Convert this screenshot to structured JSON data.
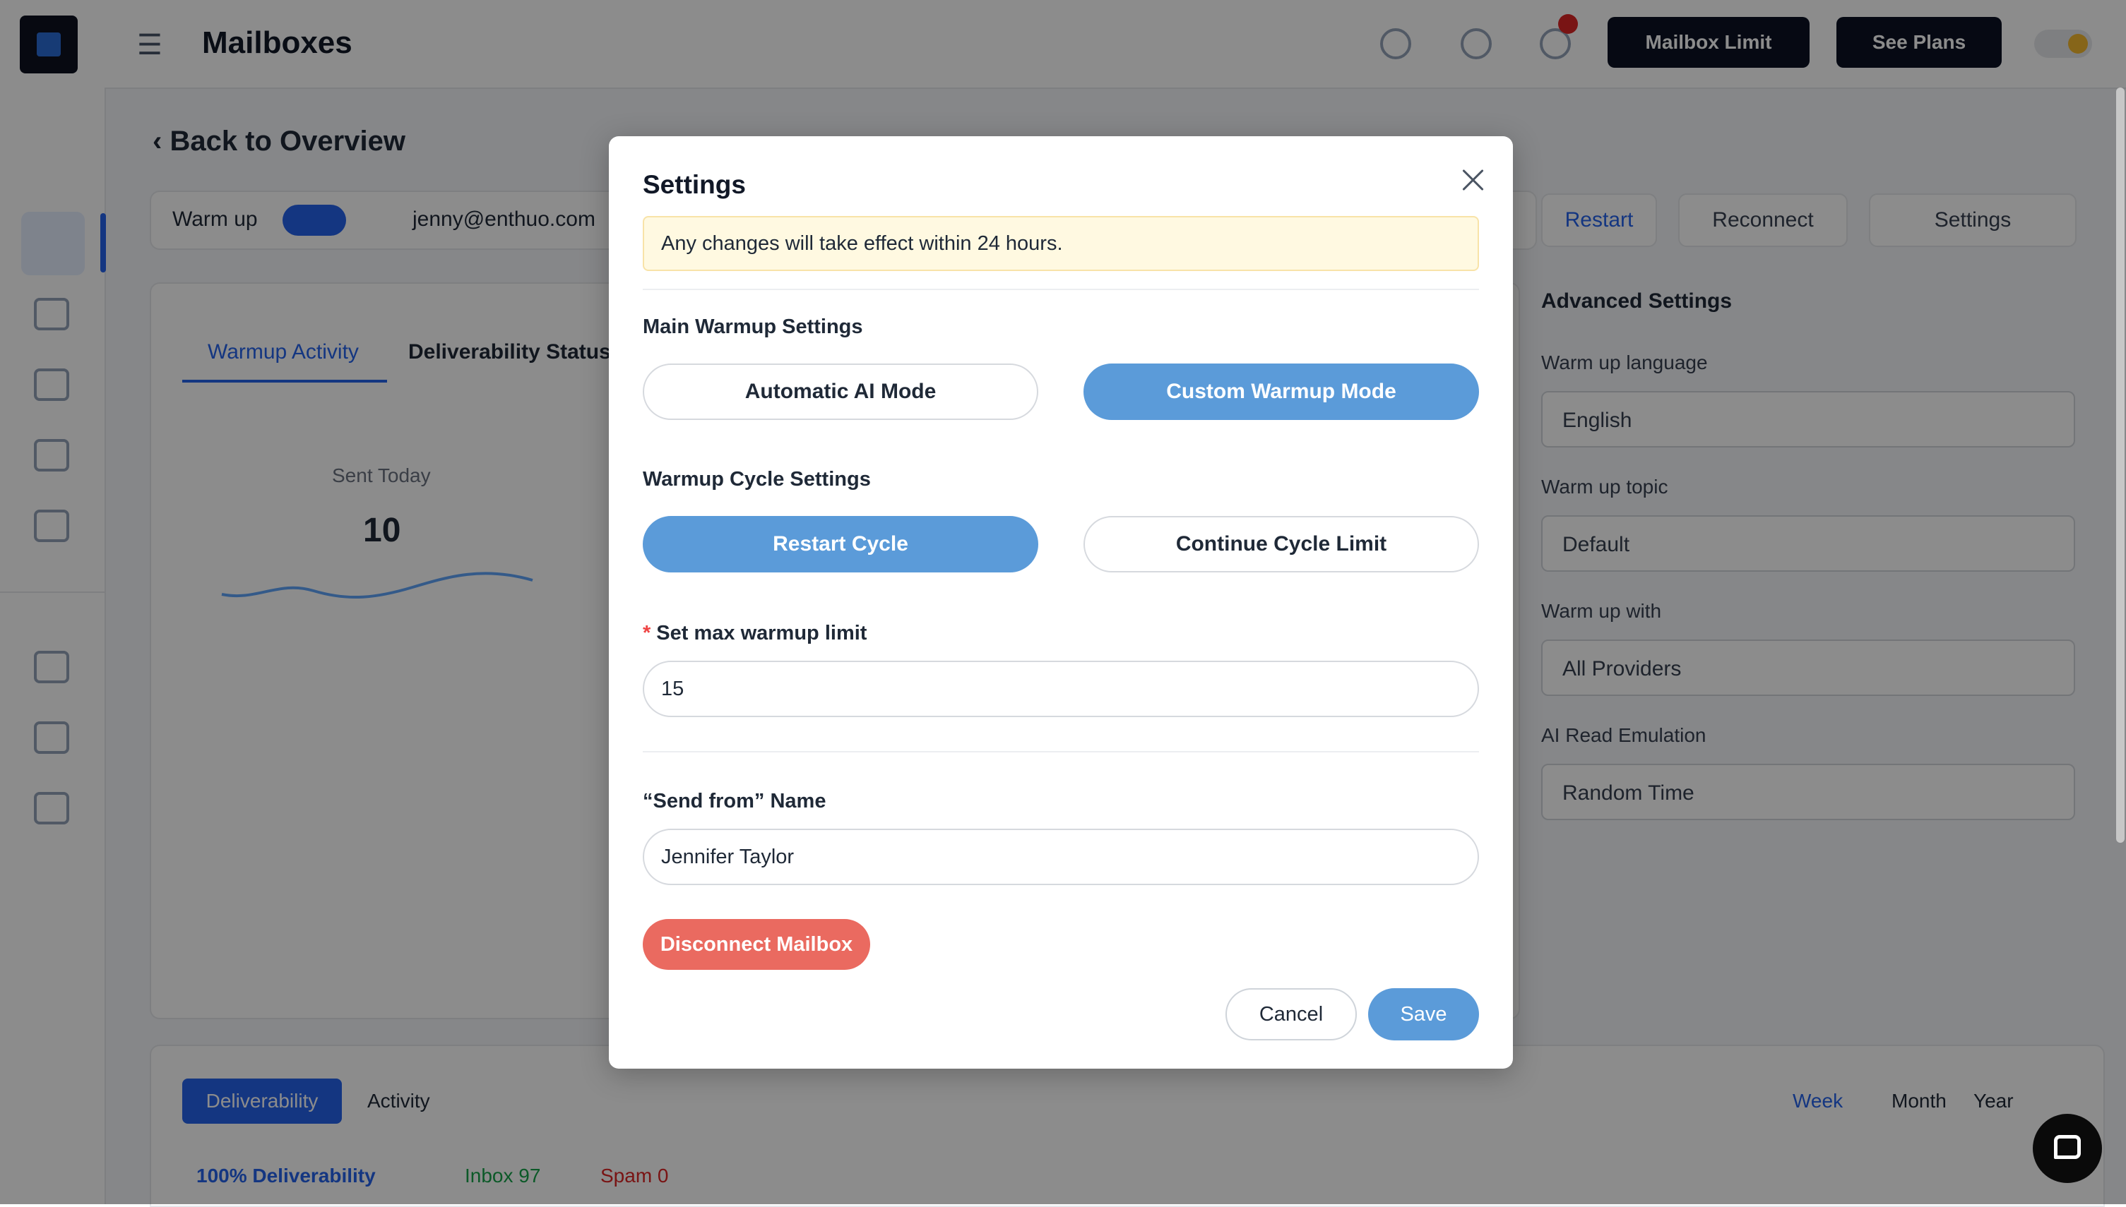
{
  "app": {
    "title": "Mailboxes",
    "mailbox_limit_label": "Mailbox Limit",
    "see_plans_label": "See Plans"
  },
  "background": {
    "back_link": "Back to Overview",
    "warmup_label": "Warm up",
    "email": "jenny@enthuo.com",
    "actions": [
      "Restart",
      "Reconnect",
      "Settings"
    ],
    "tabs": [
      "Warmup Activity",
      "Deliverability Status"
    ],
    "sent_today_label": "Sent Today",
    "sent_today_value": "10",
    "advanced_settings_title": "Advanced Settings",
    "advanced_fields": [
      {
        "label": "Warm up language",
        "value": "English"
      },
      {
        "label": "Warm up topic",
        "value": "Default"
      },
      {
        "label": "Warm up with",
        "value": "All Providers"
      },
      {
        "label": "AI Read Emulation",
        "value": "Random Time"
      }
    ],
    "bottom_tabs": [
      "Deliverability",
      "Activity"
    ],
    "range_tabs": [
      "Week",
      "Month",
      "Year"
    ],
    "stats": [
      "100% Deliverability",
      "Inbox 97",
      "Spam 0"
    ]
  },
  "modal": {
    "title": "Settings",
    "notice": "Any changes will take effect within 24 hours.",
    "main_settings_label": "Main Warmup Settings",
    "automatic_mode_label": "Automatic AI Mode",
    "custom_mode_label": "Custom Warmup Mode",
    "selected_mode": "Custom Warmup Mode",
    "cycle_settings_label": "Warmup Cycle Settings",
    "restart_cycle_label": "Restart Cycle",
    "continue_cycle_label": "Continue Cycle Limit",
    "selected_cycle": "Restart Cycle",
    "required_mark": "*",
    "max_limit_label": "Set max warmup limit",
    "max_limit_value": "15",
    "send_from_label": "“Send from” Name",
    "send_from_value": "Jennifer Taylor",
    "disconnect_label": "Disconnect Mailbox",
    "cancel_label": "Cancel",
    "save_label": "Save"
  },
  "colors": {
    "primary": "#5b9bd9",
    "danger": "#ea6a60",
    "notice_bg": "#fff9e1"
  }
}
